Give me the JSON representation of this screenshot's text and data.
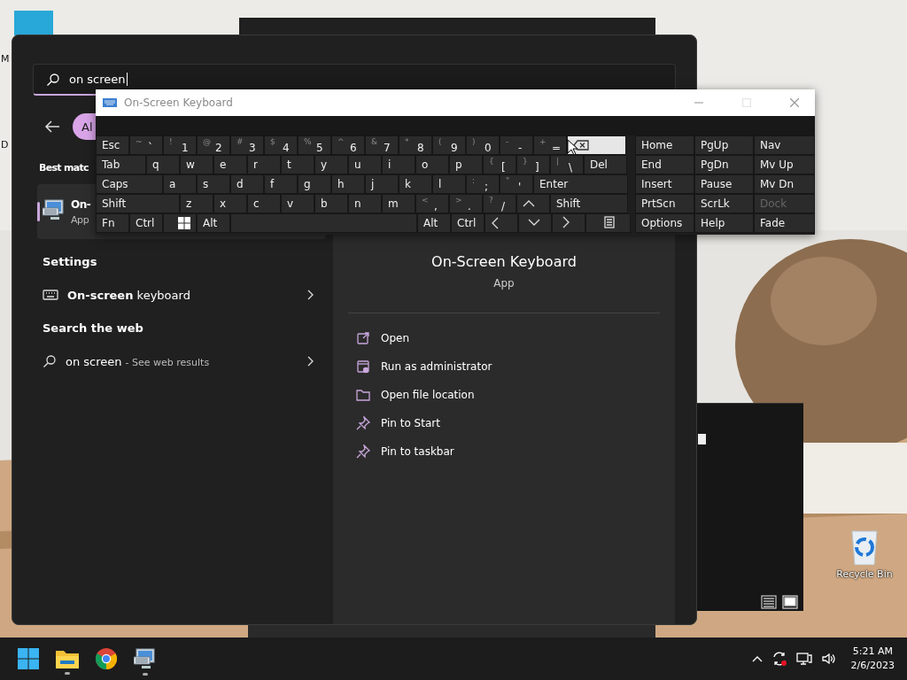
{
  "desktop": {
    "icon_labels": [
      "M",
      "D"
    ],
    "recycle_bin": "Recycle Bin"
  },
  "start": {
    "search": {
      "value": "on screen"
    },
    "filters": [
      {
        "label": "Al",
        "selected": true
      }
    ],
    "best_match": {
      "heading": "Best matc",
      "item": {
        "name": "On-",
        "type": "App",
        "selected": true
      }
    },
    "settings": {
      "heading": "Settings",
      "items": [
        {
          "label": "**On-screen** keyboard"
        }
      ]
    },
    "web": {
      "heading": "Search the web",
      "items": [
        {
          "query": "on screen",
          "hint": "- See web results"
        }
      ]
    },
    "details": {
      "title": "On-Screen Keyboard",
      "type": "App",
      "actions": [
        {
          "label": "Open",
          "kind": "open"
        },
        {
          "label": "Run as administrator",
          "kind": "admin"
        },
        {
          "label": "Open file location",
          "kind": "folder"
        },
        {
          "label": "Pin to Start",
          "kind": "pin"
        },
        {
          "label": "Pin to taskbar",
          "kind": "pin"
        }
      ]
    }
  },
  "osk": {
    "title": "On-Screen Keyboard",
    "rows": [
      {
        "keys": [
          {
            "label": "Esc"
          },
          {
            "shift": "~",
            "label": "`"
          },
          {
            "shift": "!",
            "label": "1"
          },
          {
            "shift": "@",
            "label": "2"
          },
          {
            "shift": "#",
            "label": "3"
          },
          {
            "shift": "$",
            "label": "4"
          },
          {
            "shift": "%",
            "label": "5"
          },
          {
            "shift": "^",
            "label": "6"
          },
          {
            "shift": "&",
            "label": "7"
          },
          {
            "shift": "*",
            "label": "8"
          },
          {
            "shift": "(",
            "label": "9"
          },
          {
            "shift": ")",
            "label": "0"
          },
          {
            "shift": "-",
            "label": "-"
          },
          {
            "shift": "+",
            "label": "="
          },
          {
            "kind": "backspace",
            "hovered": true
          }
        ],
        "side": [
          {
            "label": "Home",
            "disabled": false
          },
          {
            "label": "PgUp",
            "disabled": false
          },
          {
            "label": "Nav",
            "disabled": false
          }
        ]
      },
      {
        "keys": [
          {
            "label": "Tab"
          },
          {
            "label": "q"
          },
          {
            "label": "w"
          },
          {
            "label": "e"
          },
          {
            "label": "r"
          },
          {
            "label": "t"
          },
          {
            "label": "y"
          },
          {
            "label": "u"
          },
          {
            "label": "i"
          },
          {
            "label": "o"
          },
          {
            "label": "p"
          },
          {
            "shift": "{",
            "label": "["
          },
          {
            "shift": "}",
            "label": "]"
          },
          {
            "shift": "|",
            "label": "\\"
          },
          {
            "label": "Del"
          }
        ],
        "side": [
          {
            "label": "End",
            "disabled": false
          },
          {
            "label": "PgDn",
            "disabled": false
          },
          {
            "label": "Mv Up",
            "disabled": false
          }
        ]
      },
      {
        "keys": [
          {
            "label": "Caps"
          },
          {
            "label": "a"
          },
          {
            "label": "s"
          },
          {
            "label": "d"
          },
          {
            "label": "f"
          },
          {
            "label": "g"
          },
          {
            "label": "h"
          },
          {
            "label": "j"
          },
          {
            "label": "k"
          },
          {
            "label": "l"
          },
          {
            "shift": ":",
            "label": ";"
          },
          {
            "shift": "\"",
            "label": "'"
          },
          {
            "label": "Enter"
          }
        ],
        "side": [
          {
            "label": "Insert",
            "disabled": false
          },
          {
            "label": "Pause",
            "disabled": false
          },
          {
            "label": "Mv Dn",
            "disabled": false
          }
        ]
      },
      {
        "keys": [
          {
            "label": "Shift"
          },
          {
            "label": "z"
          },
          {
            "label": "x"
          },
          {
            "label": "c"
          },
          {
            "label": "v"
          },
          {
            "label": "b"
          },
          {
            "label": "n"
          },
          {
            "label": "m"
          },
          {
            "shift": "<",
            "label": ","
          },
          {
            "shift": ">",
            "label": "."
          },
          {
            "shift": "?",
            "label": "/"
          },
          {
            "kind": "up"
          },
          {
            "label": "Shift"
          }
        ],
        "side": [
          {
            "label": "PrtScn",
            "disabled": false
          },
          {
            "label": "ScrLk",
            "disabled": false
          },
          {
            "label": "Dock",
            "disabled": true
          }
        ]
      },
      {
        "keys": [
          {
            "label": "Fn"
          },
          {
            "label": "Ctrl"
          },
          {
            "kind": "windows"
          },
          {
            "label": "Alt"
          },
          {
            "kind": "space"
          },
          {
            "label": "Alt"
          },
          {
            "label": "Ctrl"
          },
          {
            "kind": "left"
          },
          {
            "kind": "down"
          },
          {
            "kind": "right"
          },
          {
            "kind": "menu"
          }
        ],
        "side": [
          {
            "label": "Options",
            "disabled": false
          },
          {
            "label": "Help",
            "disabled": false
          },
          {
            "label": "Fade",
            "disabled": false
          }
        ]
      }
    ]
  },
  "taskbar": {
    "apps": [
      {
        "kind": "start",
        "running": false
      },
      {
        "kind": "explorer",
        "running": true
      },
      {
        "kind": "chrome",
        "running": false
      },
      {
        "kind": "osk",
        "running": true
      }
    ],
    "tray": {
      "time": "5:21 AM",
      "date": "2/6/2023"
    }
  }
}
